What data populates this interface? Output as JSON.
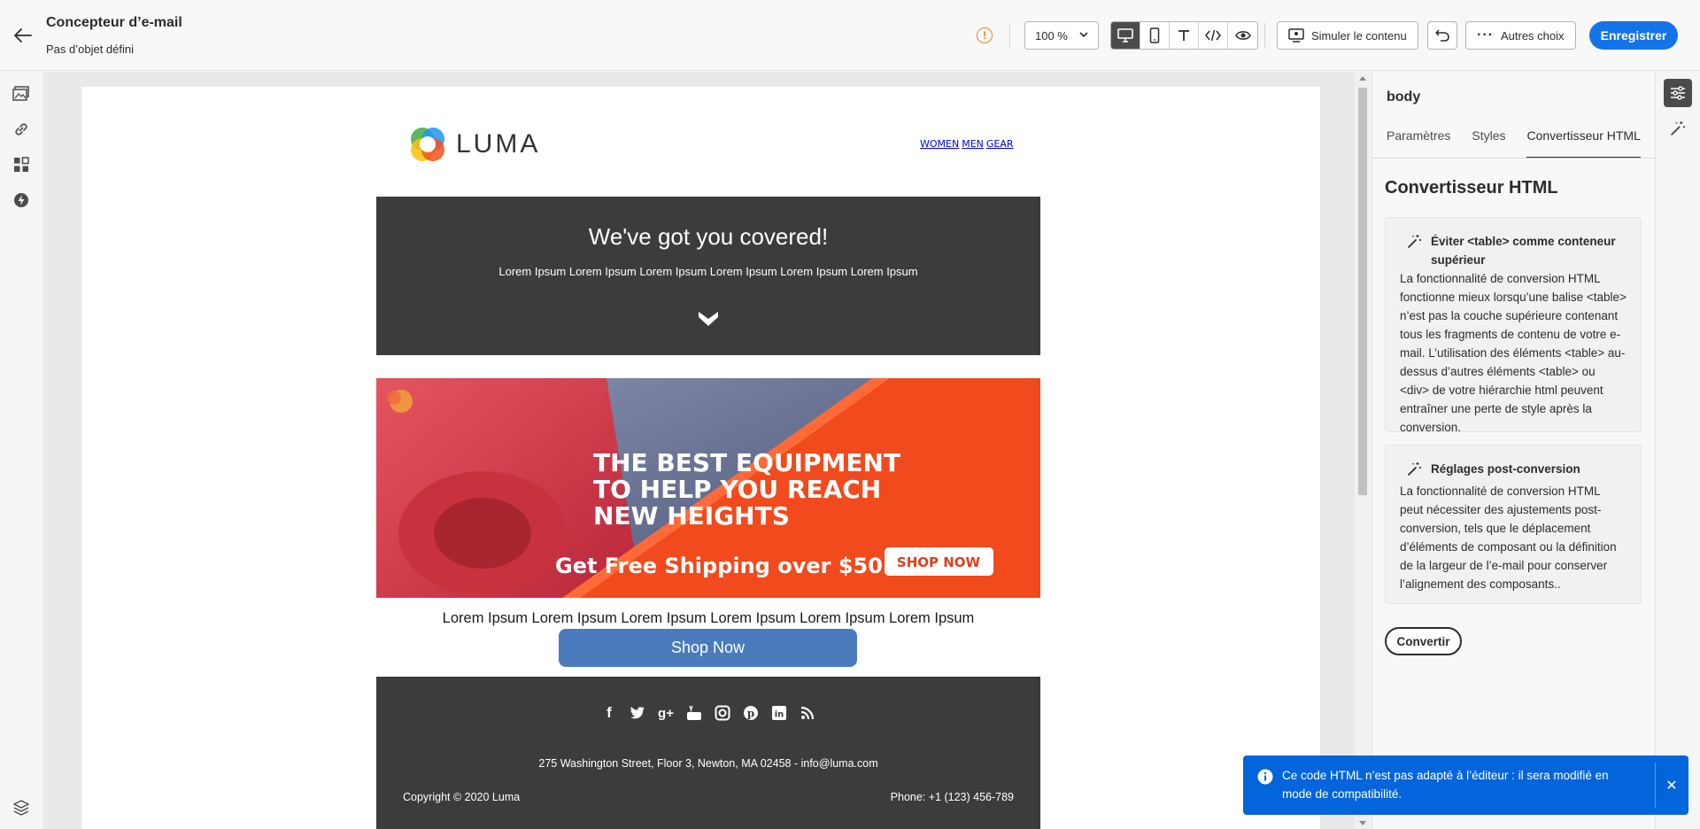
{
  "header": {
    "title": "Concepteur d’e-mail",
    "subtitle": "Pas d’objet défini",
    "zoom": "100 %",
    "simulate_label": "Simuler le contenu",
    "more_label": "Autres choix",
    "save_label": "Enregistrer"
  },
  "email": {
    "logo_text": "LUMA",
    "nav": [
      "WOMEN",
      "MEN",
      "GEAR"
    ],
    "hero_title": "We've got you covered!",
    "hero_text": "Lorem Ipsum Lorem Ipsum Lorem Ipsum Lorem Ipsum Lorem Ipsum Lorem Ipsum",
    "banner_line1": "THE BEST EQUIPMENT",
    "banner_line2": "TO HELP YOU REACH",
    "banner_line3": "NEW HEIGHTS",
    "banner_shipping": "Get Free Shipping over $50",
    "banner_cta": "SHOP NOW",
    "body_text": "Lorem Ipsum Lorem Ipsum Lorem Ipsum Lorem Ipsum Lorem Ipsum Lorem Ipsum",
    "shop_button": "Shop Now",
    "address": "275 Washington Street, Floor 3, Newton, MA 02458 - info@luma.com",
    "copyright": "Copyright © 2020 Luma",
    "phone": "Phone: +1 (123) 456-789"
  },
  "panel": {
    "element": "body",
    "tabs": [
      {
        "label": "Paramètres",
        "active": false
      },
      {
        "label": "Styles",
        "active": false
      },
      {
        "label": "Convertisseur HTML",
        "active": true
      }
    ],
    "title": "Convertisseur HTML",
    "tips": [
      {
        "title": "Éviter <table> comme conteneur supérieur",
        "body": "La fonctionnalité de conversion HTML fonctionne mieux lorsqu’une balise <table> n’est pas la couche supérieure contenant tous les fragments de contenu de votre e-mail. L’utilisation des éléments <table> au-dessus d’autres éléments <table> ou <div> de votre hiérarchie html peuvent entraîner une perte de style après la conversion."
      },
      {
        "title": "Réglages post-conversion",
        "body": "La fonctionnalité de conversion HTML peut nécessiter des ajustements post-conversion, tels que le déplacement d’éléments de composant ou la définition de la largeur de l’e-mail pour conserver l’alignement des composants.."
      }
    ],
    "convert_label": "Convertir"
  },
  "toast": {
    "message": "Ce code HTML n’est pas adapté à l’éditeur : il sera modifié en mode de compatibilité."
  },
  "colors": {
    "accent": "#1473e6",
    "toast": "#0265dc",
    "warning": "#e68619",
    "email_dark": "#3c3c3c",
    "shop_button": "#4a7bbd"
  }
}
